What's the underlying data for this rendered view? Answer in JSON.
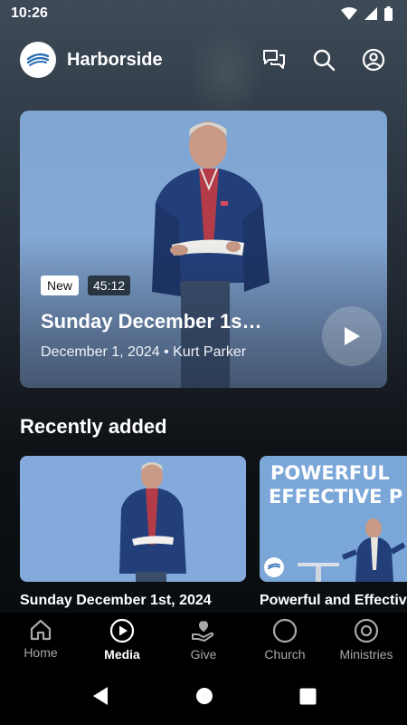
{
  "status_bar": {
    "time": "10:26",
    "icons": [
      "wifi-icon",
      "signal-icon",
      "battery-icon"
    ]
  },
  "header": {
    "title": "Harborside",
    "actions": [
      "chat-icon",
      "search-icon",
      "account-icon"
    ]
  },
  "hero": {
    "badge_new": "New",
    "duration": "45:12",
    "title": "Sunday December 1s…",
    "meta": "December 1, 2024 • Kurt Parker"
  },
  "recently_added": {
    "title": "Recently added",
    "items": [
      {
        "title": "Sunday December 1st, 2024"
      },
      {
        "title": "Powerful and Effective",
        "thumb_text_1": "POWERFUL",
        "thumb_text_2": "EFFECTIVE P"
      }
    ]
  },
  "bottom_nav": {
    "items": [
      {
        "label": "Home",
        "icon": "home-icon",
        "active": false
      },
      {
        "label": "Media",
        "icon": "play-circle-icon",
        "active": true
      },
      {
        "label": "Give",
        "icon": "give-hand-heart-icon",
        "active": false
      },
      {
        "label": "Church",
        "icon": "circle-icon",
        "active": false
      },
      {
        "label": "Ministries",
        "icon": "ring-icon",
        "active": false
      }
    ]
  },
  "colors": {
    "accent": "#2d6fb5",
    "hero_sky": "#84a9d6",
    "inactive_nav": "#a8a8a8"
  }
}
